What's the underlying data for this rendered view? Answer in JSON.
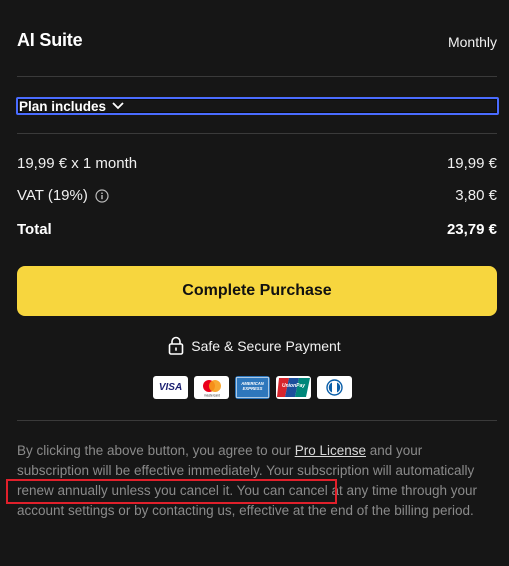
{
  "header": {
    "title": "AI Suite",
    "billing_cycle": "Monthly"
  },
  "plan_toggle": {
    "label": "Plan includes",
    "icon": "chevron-down-icon"
  },
  "summary": {
    "line_item": {
      "label": "19,99 € x 1 month",
      "value": "19,99 €"
    },
    "vat": {
      "label": "VAT (19%)",
      "value": "3,80 €",
      "icon": "info-icon"
    },
    "total": {
      "label": "Total",
      "value": "23,79 €"
    }
  },
  "cta": {
    "label": "Complete Purchase",
    "color": "#f7d63e"
  },
  "secure": {
    "label": "Safe & Secure Payment",
    "icon": "lock-icon"
  },
  "payment_methods": [
    {
      "name": "visa",
      "text": "VISA"
    },
    {
      "name": "mastercard",
      "text": "mastercard"
    },
    {
      "name": "american-express",
      "text": "AMERICAN EXPRESS"
    },
    {
      "name": "unionpay",
      "text": "UnionPay"
    },
    {
      "name": "diners-club",
      "text": ""
    }
  ],
  "legal": {
    "part1": "By clicking the above button, you agree to our ",
    "link": "Pro License",
    "part2": " and your subscription will be effective immediately. Your subscription will ",
    "highlight": "automatically renew annually unless you cancel it.",
    "part3": " You can cancel at any time through your account settings or by contacting us, effective at the end of the billing period."
  },
  "colors": {
    "background": "#161616",
    "accent": "#f7d63e",
    "focus_ring": "#4a6cff",
    "annotation": "#e0202b"
  }
}
